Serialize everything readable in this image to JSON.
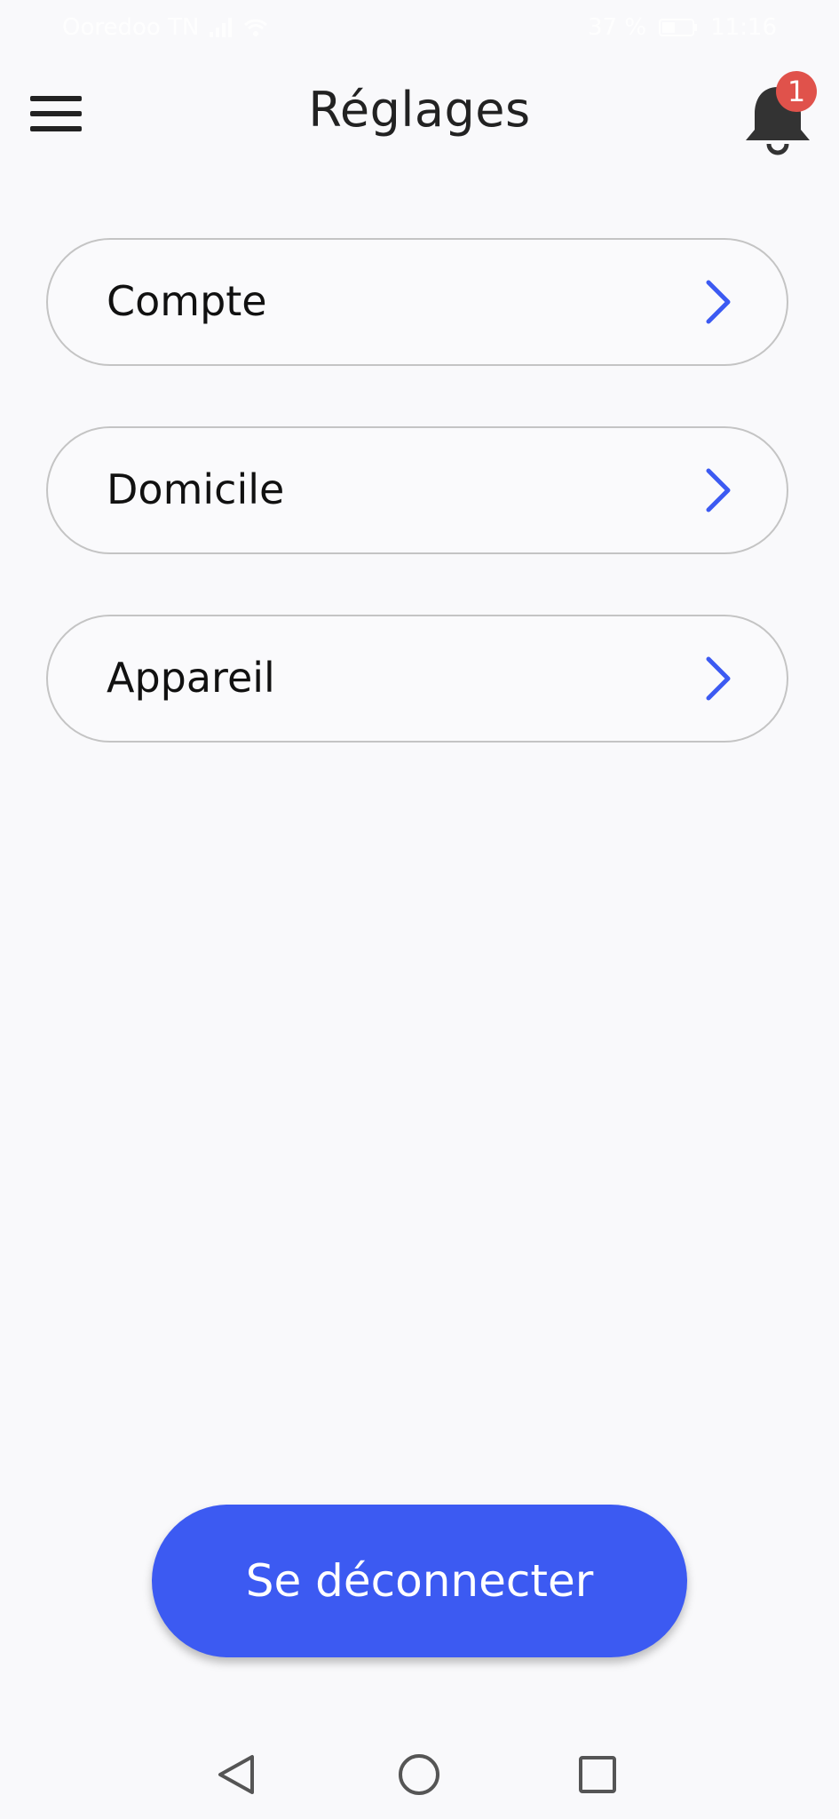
{
  "status_bar": {
    "carrier": "Ooredoo TN",
    "battery": "37 %",
    "time": "11:16",
    "icons": [
      "signal-icon",
      "wifi-icon",
      "battery-icon"
    ]
  },
  "header": {
    "title": "Réglages",
    "menu_icon": "hamburger-menu-icon",
    "notification_icon": "bell-icon",
    "notification_count": "1"
  },
  "settings": {
    "items": [
      {
        "label": "Compte",
        "icon": "chevron-right-icon"
      },
      {
        "label": "Domicile",
        "icon": "chevron-right-icon"
      },
      {
        "label": "Appareil",
        "icon": "chevron-right-icon"
      }
    ]
  },
  "logout": {
    "label": "Se déconnecter"
  },
  "nav_bar": {
    "icons": [
      "back-triangle-icon",
      "home-circle-icon",
      "recents-square-icon"
    ]
  },
  "colors": {
    "background": "#f9f9fb",
    "accent": "#3c5af2",
    "chevron": "#3c5af2",
    "badge": "#e0524b",
    "item_border": "#c4c4c4",
    "text": "#222222"
  }
}
